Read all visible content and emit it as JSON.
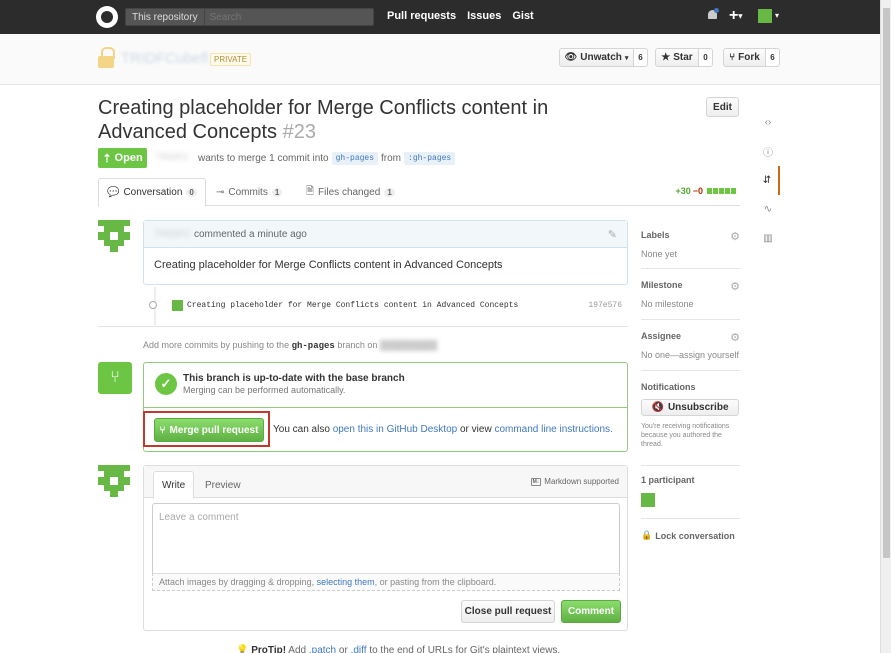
{
  "header": {
    "search_scope": "This repository",
    "search_placeholder": "Search",
    "nav": [
      "Pull requests",
      "Issues",
      "Gist"
    ],
    "plus_label": "+"
  },
  "repo": {
    "name": "TRIDFCubefl",
    "private_label": "PRIVATE",
    "watch": {
      "label": "Unwatch",
      "count": "6"
    },
    "star": {
      "label": "Star",
      "count": "0"
    },
    "fork": {
      "label": "Fork",
      "count": "6"
    }
  },
  "pr": {
    "title": "Creating placeholder for Merge Conflicts content in Advanced Concepts",
    "number": "#23",
    "edit_label": "Edit",
    "state": "Open",
    "author": "TRIDFC",
    "merge_text": "wants to merge 1 commit into",
    "base_branch": "gh-pages",
    "from_text": "from",
    "head_branch": ":gh-pages"
  },
  "tabs": [
    {
      "label": "Conversation",
      "count": "0"
    },
    {
      "label": "Commits",
      "count": "1"
    },
    {
      "label": "Files changed",
      "count": "1"
    }
  ],
  "diffstat": {
    "additions": "+30",
    "deletions": "−0"
  },
  "comment": {
    "author": "TRIDFC",
    "time": "commented a minute ago",
    "body": "Creating placeholder for Merge Conflicts content in Advanced Concepts"
  },
  "commit": {
    "message": "Creating placeholder for Merge Conflicts content in Advanced Concepts",
    "sha": "197e576"
  },
  "add_commits": {
    "prefix": "Add more commits by pushing to the",
    "branch": "gh-pages",
    "suffix": "branch on"
  },
  "merge": {
    "title": "This branch is up-to-date with the base branch",
    "subtitle": "Merging can be performed automatically.",
    "button": "Merge pull request",
    "alt_prefix": "You can also",
    "alt_link1": "open this in GitHub Desktop",
    "alt_mid": "or view",
    "alt_link2": "command line instructions."
  },
  "new_comment": {
    "tab_write": "Write",
    "tab_preview": "Preview",
    "markdown_note": "Markdown supported",
    "placeholder": "Leave a comment",
    "attach_prefix": "Attach images by dragging & dropping,",
    "attach_link": "selecting them",
    "attach_suffix": ", or pasting from the clipboard.",
    "close_button": "Close pull request",
    "comment_button": "Comment"
  },
  "protip": {
    "label": "ProTip!",
    "text_a": "Add",
    "link_a": ".patch",
    "text_b": "or",
    "link_b": ".diff",
    "text_c": "to the end of URLs for Git's plaintext views."
  },
  "sidebar": {
    "labels_title": "Labels",
    "labels_value": "None yet",
    "milestone_title": "Milestone",
    "milestone_value": "No milestone",
    "assignee_title": "Assignee",
    "assignee_value": "No one—assign yourself",
    "notifications_title": "Notifications",
    "unsubscribe": "Unsubscribe",
    "notifications_note": "You're receiving notifications because you authored the thread.",
    "participants_title": "1 participant",
    "lock_label": "Lock conversation"
  }
}
